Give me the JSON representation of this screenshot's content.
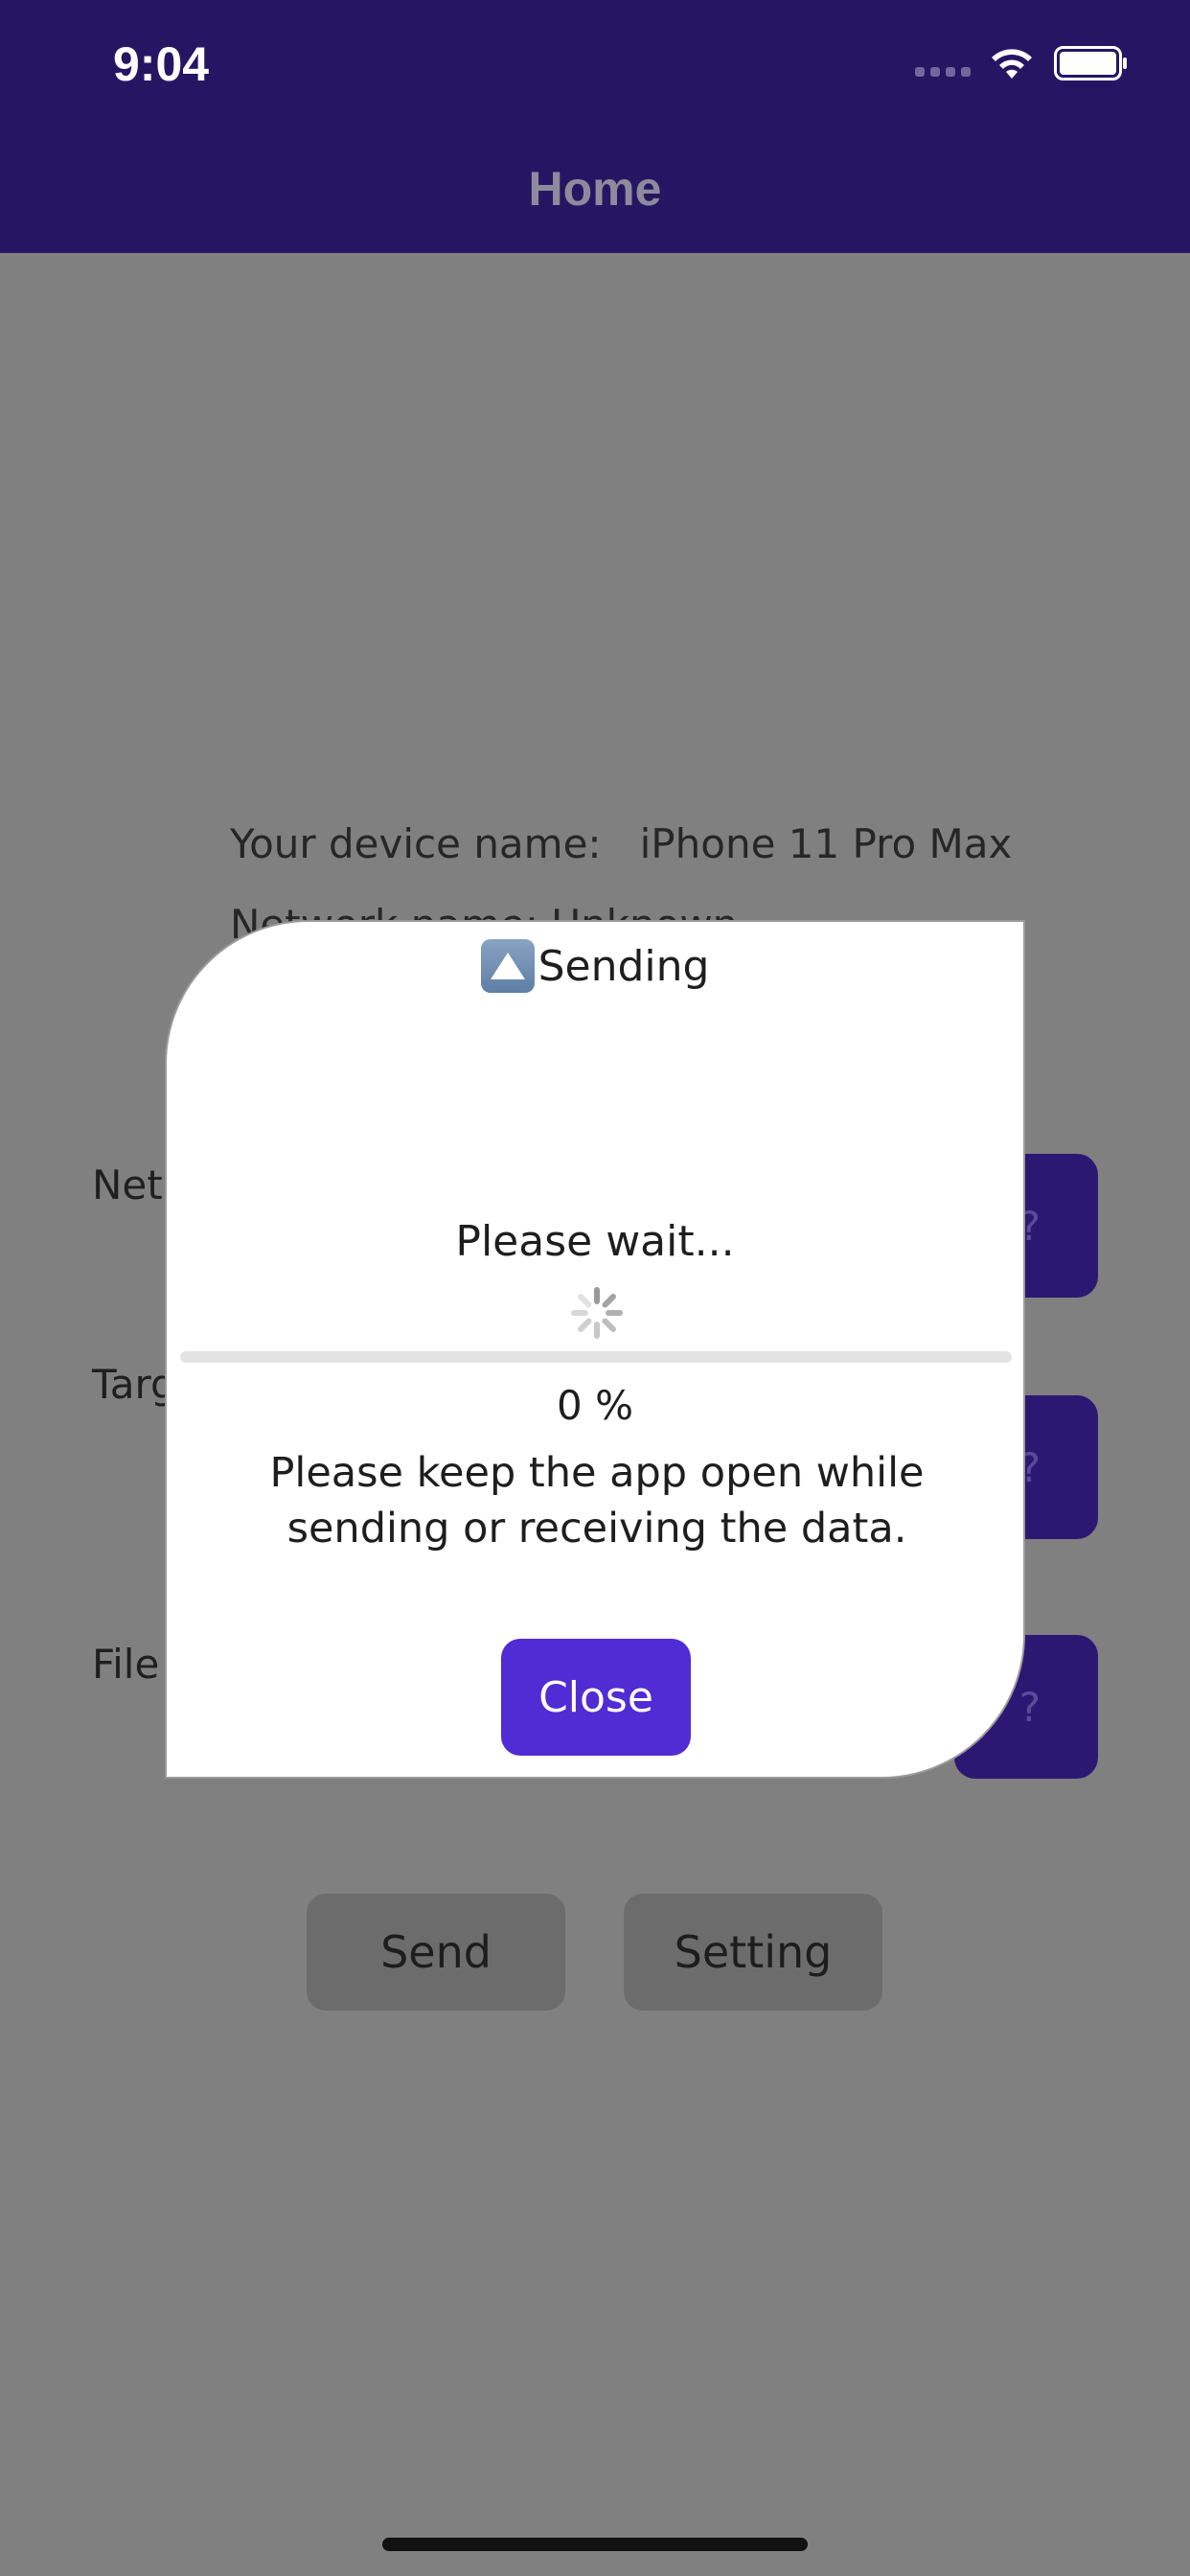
{
  "status_bar": {
    "time": "9:04"
  },
  "header": {
    "title": "Home"
  },
  "background": {
    "device_name_label": "Your device name:",
    "device_name_value": "iPhone 11 Pro Max",
    "network_line_partial": "Network name:    Unknown",
    "labels": [
      "Netw",
      "Targ",
      "File"
    ],
    "help_glyph": "?",
    "send_label": "Send",
    "setting_label": "Setting"
  },
  "dialog": {
    "title": "Sending",
    "title_icon": "up-arrow-button-icon",
    "wait_text": "Please wait...",
    "progress_percent_text": "0 %",
    "progress_fraction": 0,
    "message": "Please keep the app open while sending or receiving the data.",
    "close_label": "Close"
  },
  "colors": {
    "header_bg": "#251663",
    "overlay_bg": "#808080",
    "accent": "#512bd4",
    "help_button_bg": "#2a1872"
  }
}
